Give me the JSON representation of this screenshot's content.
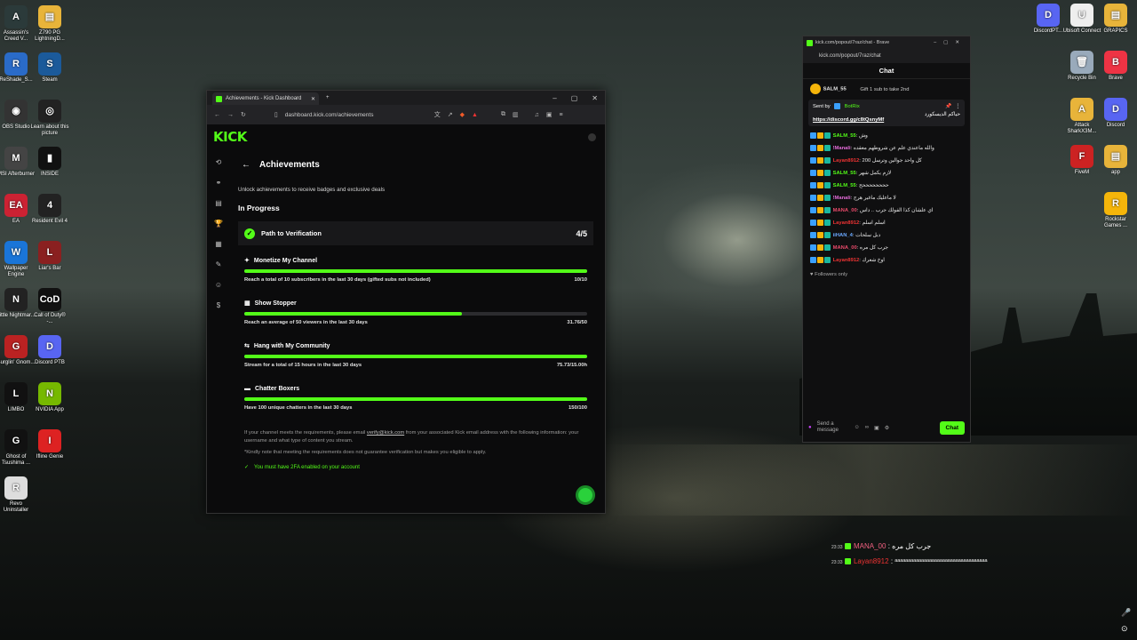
{
  "desktop_left": [
    {
      "label": "Assassin's Creed V...",
      "color": "#2b3a3a",
      "glyph": "A"
    },
    {
      "label": "Z790 PG LightningD...",
      "color": "#e8b43a",
      "glyph": "▤"
    },
    {
      "label": "ReShade_S...",
      "color": "#2a6bc8",
      "glyph": "R"
    },
    {
      "label": "Steam",
      "color": "#1b5a9a",
      "glyph": "S"
    },
    {
      "label": "OBS Studio",
      "color": "#333",
      "glyph": "◉"
    },
    {
      "label": "Learn about this picture",
      "color": "#222",
      "glyph": "◎"
    },
    {
      "label": "MSI Afterburner",
      "color": "#444",
      "glyph": "M"
    },
    {
      "label": "INSIDE",
      "color": "#111",
      "glyph": "▮"
    },
    {
      "label": "EA",
      "color": "#c23",
      "glyph": "EA"
    },
    {
      "label": "Resident Evil 4",
      "color": "#222",
      "glyph": "4"
    },
    {
      "label": "Wallpaper Engine",
      "color": "#1a75d8",
      "glyph": "W"
    },
    {
      "label": "Liar's Bar",
      "color": "#8a2020",
      "glyph": "L"
    },
    {
      "label": "Little Nightmar...",
      "color": "#222",
      "glyph": "N"
    },
    {
      "label": "Call of Duty® -...",
      "color": "#111",
      "glyph": "CoD"
    },
    {
      "label": "Burglin' Gnom...",
      "color": "#b22",
      "glyph": "G"
    },
    {
      "label": "Discord PTB",
      "color": "#5865f2",
      "glyph": "D"
    },
    {
      "label": "LIMBO",
      "color": "#111",
      "glyph": "L"
    },
    {
      "label": "NVIDIA App",
      "color": "#76b900",
      "glyph": "N"
    },
    {
      "label": "Ghost of Tsushima ...",
      "color": "#111",
      "glyph": "G"
    },
    {
      "label": "Ifline Genie",
      "color": "#d22",
      "glyph": "I"
    },
    {
      "label": "Revo Uninstaller",
      "color": "#ddd",
      "glyph": "R"
    }
  ],
  "desktop_right": [
    {
      "label": "DiscordPT...",
      "color": "#5865f2",
      "glyph": "D"
    },
    {
      "label": "Ubisoft Connect",
      "color": "#eee",
      "glyph": "U"
    },
    {
      "label": "GRAPICS",
      "color": "#e8b43a",
      "glyph": "▤"
    },
    {
      "label": "Recycle Bin",
      "color": "#9ab",
      "glyph": "🗑"
    },
    {
      "label": "Brave",
      "color": "#e34",
      "glyph": "B"
    },
    {
      "label": "Attack SharkX3M...",
      "color": "#e8b43a",
      "glyph": "A"
    },
    {
      "label": "Discord",
      "color": "#5865f2",
      "glyph": "D"
    },
    {
      "label": "FiveM",
      "color": "#c22",
      "glyph": "F"
    },
    {
      "label": "app",
      "color": "#e8b43a",
      "glyph": "▤"
    },
    {
      "label": "Rockstar Games ...",
      "color": "#f5b50a",
      "glyph": "R"
    }
  ],
  "browser": {
    "tab_title": "Achievements - Kick Dashboard",
    "url": "dashboard.kick.com/achievements",
    "logo": "KICK",
    "page_title": "Achievements",
    "subtitle": "Unlock achievements to receive badges and exclusive deals",
    "section": "In Progress",
    "card_title": "Path to Verification",
    "card_count": "4/5",
    "items": [
      {
        "name": "Monetize My Channel",
        "desc": "Reach a total of 10 subscribers in the last 30 days (gifted subs not included)",
        "value": "10/10",
        "progress": 1.0
      },
      {
        "name": "Show Stopper",
        "desc": "Reach an average of 50 viewers in the last 30 days",
        "value": "31.76/50",
        "progress": 0.635
      },
      {
        "name": "Hang with My Community",
        "desc": "Stream for a total of 15 hours in the last 30 days",
        "value": "75.73/15.00h",
        "progress": 1.0
      },
      {
        "name": "Chatter Boxers",
        "desc": "Have 100 unique chatters in the last 30 days",
        "value": "150/100",
        "progress": 1.0
      }
    ],
    "note1_a": "If your channel meets the requirements, please email ",
    "note1_link": "verify@kick.com",
    "note1_b": " from your associated Kick email address with the following information: your username and what type of content you stream.",
    "note2": "*Kindly note that meeting the requirements does not guarantee verification but makes you eligible to apply.",
    "twofa": "You must have 2FA enabled on your account"
  },
  "chat": {
    "window_title": "kick.com/popout/7raz/chat - Brave",
    "url": "kick.com/popout/7raz/chat",
    "header": "Chat",
    "gift_user": "SALM_55",
    "gift_text": "Gift 1 sub to take 2nd",
    "pinned_by": "Sent by",
    "pinned_user": "BotRix",
    "pinned_line1": "حياكم الديسكورد",
    "pinned_link": "https://discord.gg/c8tQsnyMf",
    "messages": [
      {
        "user": "SALM_55",
        "color": "#53fc18",
        "text": "وش"
      },
      {
        "user": "!Manali",
        "color": "#e36bd8",
        "text": "والله ماعندي علم عن شروطهم معقده"
      },
      {
        "user": "Layan8912",
        "color": "#e33",
        "text": "كل واحد جوالين وترسل 200"
      },
      {
        "user": "SALM_55",
        "color": "#53fc18",
        "text": "لازم يكمل شهر"
      },
      {
        "user": "SALM_55",
        "color": "#53fc18",
        "text": "ححححححححح"
      },
      {
        "user": "!Manali",
        "color": "#e36bd8",
        "text": "لا ماعليك ماغير هرج"
      },
      {
        "user": "MANA_00",
        "color": "#e84a6a",
        "text": "اي علشان كذا الفولك جرب .. داس"
      },
      {
        "user": "Layan8912",
        "color": "#e33",
        "text": "اسلم اسلم"
      },
      {
        "user": "iiHAN_4",
        "color": "#6aa8ff",
        "text": "دبل سلحات"
      },
      {
        "user": "MANA_00",
        "color": "#e84a6a",
        "text": "جرب كل مره"
      },
      {
        "user": "Layan8912",
        "color": "#e33",
        "text": "اوخ شعرك"
      }
    ],
    "followers_only": "Followers only",
    "input_placeholder": "Send a message",
    "chat_button": "Chat"
  },
  "overlay": [
    {
      "time": "23:33",
      "user": "MANA_00",
      "color": "#f06080",
      "text": ": جرب كل مره"
    },
    {
      "time": "23:33",
      "user": "Layan8912",
      "color": "#e33",
      "text": ": ᵃᵃᵃᵃᵃᵃᵃᵃᵃᵃᵃᵃᵃᵃᵃᵃᵃᵃᵃᵃᵃᵃᵃᵃᵃᵃᵃᵃᵃᵃᵃᵃᵃᵃᵃ"
    }
  ]
}
